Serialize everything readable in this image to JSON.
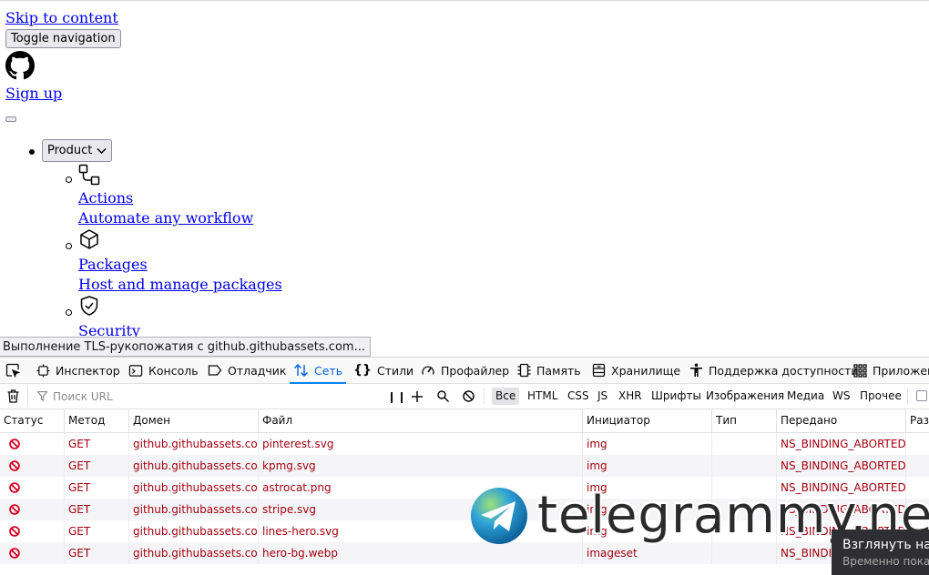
{
  "page": {
    "skip_link": "Skip to content",
    "toggle_nav": "Toggle navigation",
    "sign_up": "Sign up",
    "product_menu": "Product",
    "product_items": [
      {
        "icon": "workflow-icon",
        "title": "Actions",
        "desc": "Automate any workflow"
      },
      {
        "icon": "package-icon",
        "title": "Packages",
        "desc": "Host and manage packages"
      },
      {
        "icon": "shield-check-icon",
        "title": "Security",
        "desc": ""
      }
    ]
  },
  "status_tooltip": "Выполнение TLS-рукопожатия с github.githubassets.com...",
  "devtools": {
    "tabs": [
      {
        "label": "Инспектор",
        "icon": "inspector-icon"
      },
      {
        "label": "Консоль",
        "icon": "console-icon"
      },
      {
        "label": "Отладчик",
        "icon": "debugger-icon"
      },
      {
        "label": "Сеть",
        "icon": "network-icon"
      },
      {
        "label": "Стили",
        "icon": "style-editor-icon"
      },
      {
        "label": "Профайлер",
        "icon": "profiler-icon"
      },
      {
        "label": "Память",
        "icon": "memory-icon"
      },
      {
        "label": "Хранилище",
        "icon": "storage-icon"
      },
      {
        "label": "Поддержка доступности",
        "icon": "accessibility-icon"
      },
      {
        "label": "Приложения",
        "icon": "application-icon"
      }
    ],
    "active_tab": "Сеть",
    "toolbar": {
      "url_placeholder": "Поиск URL",
      "filters": [
        "Все",
        "HTML",
        "CSS",
        "JS",
        "XHR",
        "Шрифты",
        "Изображения",
        "Медиа",
        "WS",
        "Прочее"
      ],
      "active_filter": "Все"
    },
    "columns": [
      "Статус",
      "Метод",
      "Домен",
      "Файл",
      "Инициатор",
      "Тип",
      "Передано",
      "Размер"
    ],
    "rows": [
      {
        "method": "GET",
        "domain": "github.githubassets.com",
        "file": "pinterest.svg",
        "initiator": "img",
        "type": "",
        "transferred": "NS_BINDING_ABORTED"
      },
      {
        "method": "GET",
        "domain": "github.githubassets.com",
        "file": "kpmg.svg",
        "initiator": "img",
        "type": "",
        "transferred": "NS_BINDING_ABORTED"
      },
      {
        "method": "GET",
        "domain": "github.githubassets.com",
        "file": "astrocat.png",
        "initiator": "img",
        "type": "",
        "transferred": "NS_BINDING_ABORTED"
      },
      {
        "method": "GET",
        "domain": "github.githubassets.com",
        "file": "stripe.svg",
        "initiator": "img",
        "type": "",
        "transferred": "NS_BINDING_ABORTED"
      },
      {
        "method": "GET",
        "domain": "github.githubassets.com",
        "file": "lines-hero.svg",
        "initiator": "img",
        "type": "",
        "transferred": "NS_BINDING_ABORTED"
      },
      {
        "method": "GET",
        "domain": "github.githubassets.com",
        "file": "hero-bg.webp",
        "initiator": "imageset",
        "type": "",
        "transferred": "NS_BINDING_ABORTED"
      }
    ]
  },
  "watermark": {
    "text": "telegrammy.net"
  },
  "notification": {
    "title": "Взглянуть на",
    "subtitle": "Временно пока"
  },
  "colors": {
    "link": "#0000ee",
    "error_text": "#a4000f",
    "active_tab": "#0060df",
    "blocked_icon": "#d70022"
  }
}
